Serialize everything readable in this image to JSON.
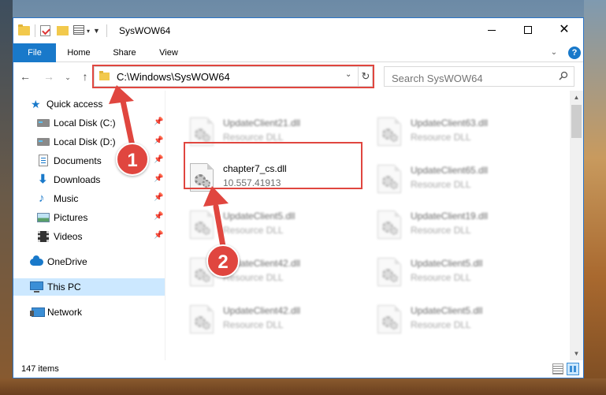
{
  "window": {
    "title": "SysWOW64",
    "controls": {
      "minimize": "",
      "maximize": "",
      "close": "✕"
    }
  },
  "ribbon": {
    "tabs": [
      {
        "label": "File",
        "active": true
      },
      {
        "label": "Home",
        "active": false
      },
      {
        "label": "Share",
        "active": false
      },
      {
        "label": "View",
        "active": false
      }
    ],
    "help": "?"
  },
  "navigation": {
    "back": "←",
    "forward": "→",
    "up": "↑",
    "address": "C:\\Windows\\SysWOW64",
    "search_placeholder": "Search SysWOW64"
  },
  "sidebar": {
    "quick_access": "Quick access",
    "items": [
      {
        "label": "Local Disk (C:)",
        "icon": "disk-icon",
        "pinned": true
      },
      {
        "label": "Local Disk (D:)",
        "icon": "disk-icon",
        "pinned": true
      },
      {
        "label": "Documents",
        "icon": "document-icon",
        "pinned": true
      },
      {
        "label": "Downloads",
        "icon": "download-icon",
        "pinned": true
      },
      {
        "label": "Music",
        "icon": "music-icon",
        "pinned": true
      },
      {
        "label": "Pictures",
        "icon": "pictures-icon",
        "pinned": true
      },
      {
        "label": "Videos",
        "icon": "videos-icon",
        "pinned": true
      }
    ],
    "onedrive": "OneDrive",
    "this_pc": "This PC",
    "network": "Network"
  },
  "files": {
    "highlighted": {
      "name": "chapter7_cs.dll",
      "sub": "10.557.41913"
    },
    "left_column": [
      {
        "name": "UpdateClient21.dll",
        "sub": "Resource DLL"
      },
      {
        "name": "UpdateClient5.dll",
        "sub": "Resource DLL"
      },
      {
        "name": "UpdateClient42.dll",
        "sub": "Resource DLL"
      },
      {
        "name": "UpdateClient42.dll",
        "sub": "Resource DLL"
      }
    ],
    "right_column": [
      {
        "name": "UpdateClient63.dll",
        "sub": "Resource DLL"
      },
      {
        "name": "UpdateClient65.dll",
        "sub": "Resource DLL"
      },
      {
        "name": "UpdateClient19.dll",
        "sub": "Resource DLL"
      },
      {
        "name": "UpdateClient5.dll",
        "sub": "Resource DLL"
      },
      {
        "name": "UpdateClient5.dll",
        "sub": "Resource DLL"
      }
    ]
  },
  "status": {
    "count": "147 items"
  },
  "annotations": {
    "step1": "1",
    "step2": "2"
  },
  "colors": {
    "accent": "#1979ca",
    "highlight": "#e0463f"
  }
}
